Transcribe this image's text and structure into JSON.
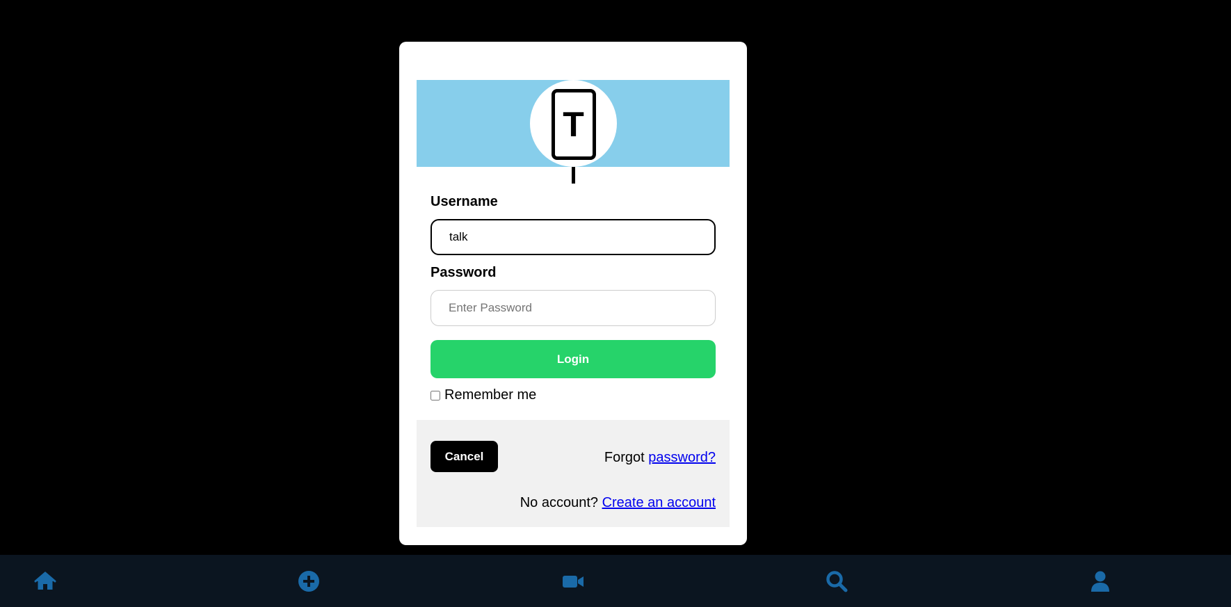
{
  "login_modal": {
    "logo_letter": "T",
    "username_label": "Username",
    "username_value": "talk",
    "password_label": "Password",
    "password_placeholder": "Enter Password",
    "login_button": "Login",
    "remember_label": "Remember me",
    "remember_checked": false,
    "cancel_button": "Cancel",
    "forgot_prefix": "Forgot",
    "forgot_link": "password?",
    "account_prefix": "No account?",
    "account_link": "Create an account"
  },
  "bottom_nav": {
    "items": [
      {
        "icon": "home-icon"
      },
      {
        "icon": "plus-circle-icon"
      },
      {
        "icon": "video-camera-icon"
      },
      {
        "icon": "search-icon"
      },
      {
        "icon": "user-icon"
      }
    ]
  },
  "colors": {
    "page_background": "#000000",
    "banner": "#87ceeb",
    "login_button": "#26d36a",
    "cancel_button": "#000000",
    "footer_panel": "#f1f1f1",
    "nav_background": "#0b1520",
    "nav_icon": "#1a6aa8",
    "link": "#0000ee"
  }
}
